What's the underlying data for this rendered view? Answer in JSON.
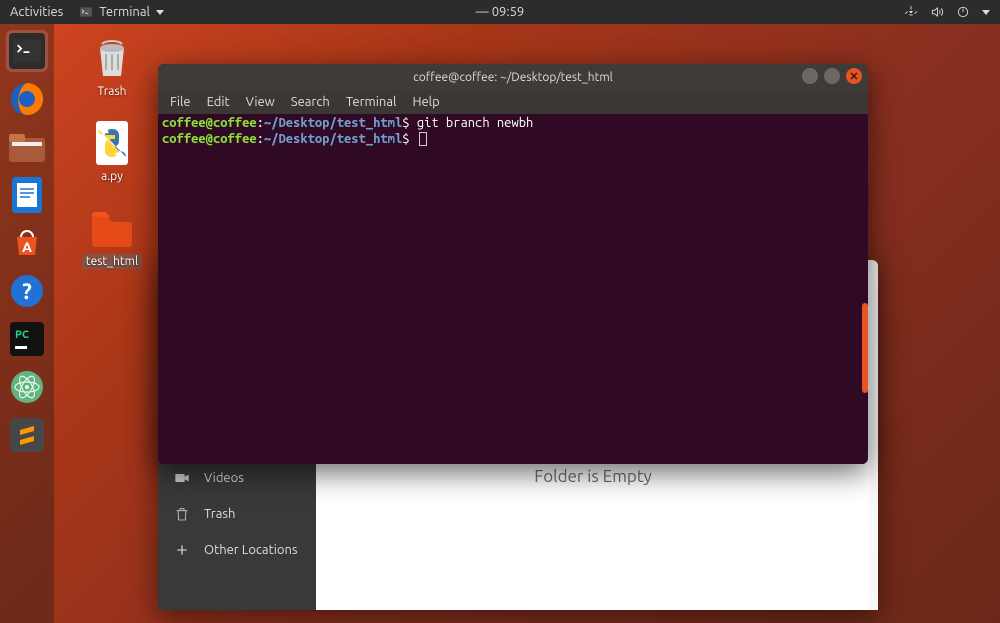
{
  "topbar": {
    "activities_label": "Activities",
    "app_label": "Terminal",
    "clock": "09:59"
  },
  "dock": {
    "items": [
      {
        "name": "terminal-icon"
      },
      {
        "name": "firefox-icon"
      },
      {
        "name": "files-icon"
      },
      {
        "name": "writer-icon"
      },
      {
        "name": "software-icon"
      },
      {
        "name": "help-icon"
      },
      {
        "name": "pycharm-icon"
      },
      {
        "name": "atom-icon"
      },
      {
        "name": "sublime-icon"
      }
    ]
  },
  "desktop": {
    "icons": [
      {
        "label": "Trash"
      },
      {
        "label": "a.py"
      },
      {
        "label": "test_html"
      }
    ]
  },
  "terminal": {
    "title": "coffee@coffee: ~/Desktop/test_html",
    "menu": [
      "File",
      "Edit",
      "View",
      "Search",
      "Terminal",
      "Help"
    ],
    "prompt_user": "coffee@coffee",
    "prompt_sep": ":",
    "prompt_path": "~/Desktop/test_html",
    "prompt_symbol": "$",
    "lines": [
      {
        "command": "git branch newbh"
      },
      {
        "command": ""
      }
    ]
  },
  "files": {
    "sidebar": {
      "videos": "Videos",
      "trash": "Trash",
      "other": "Other Locations"
    },
    "empty_label": "Folder is Empty"
  }
}
